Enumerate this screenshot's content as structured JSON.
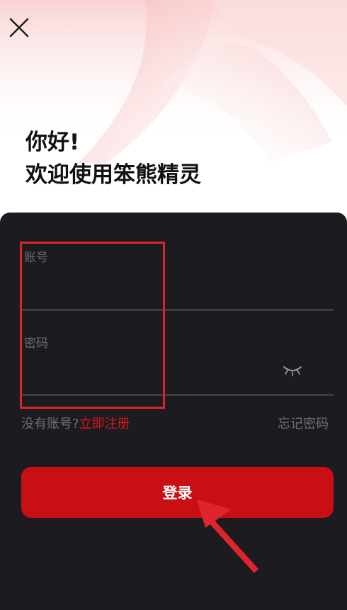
{
  "greeting": {
    "line1": "你好!",
    "line2": "欢迎使用笨熊精灵"
  },
  "form": {
    "account_label": "账号",
    "account_value": "",
    "password_label": "密码",
    "password_value": ""
  },
  "links": {
    "no_account_text": "没有账号?",
    "register_label": "立即注册",
    "forgot_label": "忘记密码"
  },
  "login_button_label": "登录",
  "icons": {
    "close": "close-icon",
    "password_visibility": "eye-closed-icon",
    "pointer": "arrow-icon"
  },
  "colors": {
    "accent": "#c80f13",
    "link": "#d7171a",
    "panel": "#1c1b1f",
    "annotation": "#e0242b"
  }
}
